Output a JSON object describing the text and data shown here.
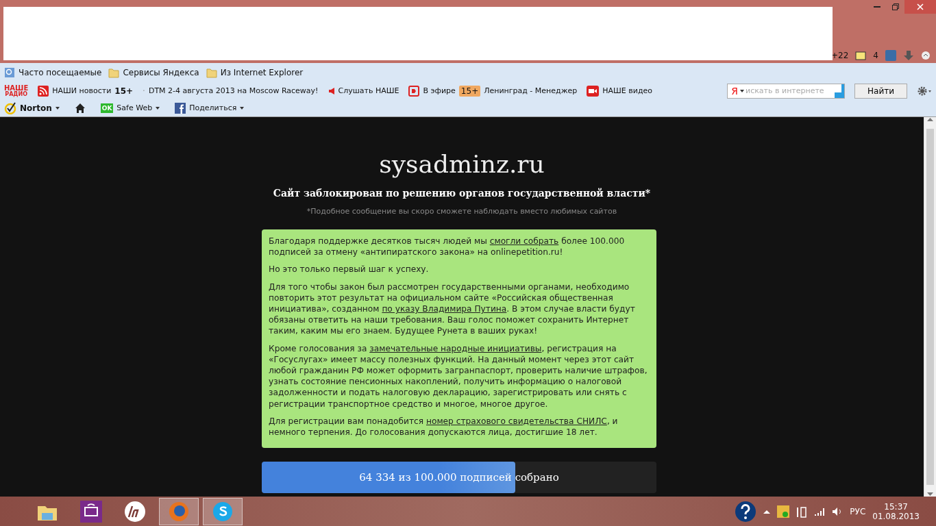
{
  "nav_bar": {
    "weather": "+22",
    "mail_count": "4"
  },
  "bookmarks": [
    {
      "kind": "search",
      "label": "Часто посещаемые"
    },
    {
      "kind": "folder",
      "label": "Сервисы Яндекса"
    },
    {
      "kind": "folder",
      "label": "Из Internet Explorer"
    }
  ],
  "radio_bar": {
    "logo_top": "НАШЕ",
    "logo_bottom": "РАДИО",
    "items": [
      {
        "kind": "rss",
        "label": "НАШИ новости",
        "badge": "15+"
      },
      {
        "kind": "dot",
        "label": "DTM 2-4 августа 2013 на Moscow Raceway!"
      },
      {
        "kind": "speaker",
        "label": "Слушать НАШЕ"
      },
      {
        "kind": "live",
        "label": "В эфире",
        "badge": "15+",
        "extra": "Ленинград - Менеджер"
      },
      {
        "kind": "video",
        "label": "НАШЕ видео"
      }
    ],
    "separator": "·",
    "search": {
      "logo": "Я",
      "placeholder": "искать в интернете",
      "button": "Найти"
    }
  },
  "norton_bar": {
    "brand": "Norton",
    "safe_web_badge": "OK",
    "safe_web": "Safe Web",
    "share": "Поделиться"
  },
  "page": {
    "site": "sysadminz.ru",
    "headline": "Сайт заблокирован по решению органов государственной власти*",
    "note": "*Подобное сообщение вы скоро сможете наблюдать вместо любимых сайтов",
    "paragraphs": [
      [
        {
          "kind": "text",
          "text": "Благодаря поддержке десятков тысяч людей мы "
        },
        {
          "kind": "link",
          "text": "смогли собрать"
        },
        {
          "kind": "text",
          "text": " более 100.000 подписей за отмену «антипиратского закона» на onlinepetition.ru!"
        }
      ],
      [
        {
          "kind": "text",
          "text": "Но это только первый шаг к успеху."
        }
      ],
      [
        {
          "kind": "text",
          "text": "Для того чтобы закон был рассмотрен государственными органами, необходимо повторить этот результат на официальном сайте «Российская общественная инициатива», созданном "
        },
        {
          "kind": "link",
          "text": "по указу Владимира Путина"
        },
        {
          "kind": "text",
          "text": ". В этом случае власти будут обязаны ответить на наши требования. Ваш голос поможет сохранить Интернет таким, каким мы его знаем. Будущее Рунета в ваших руках!"
        }
      ],
      [
        {
          "kind": "text",
          "text": "Кроме голосования за "
        },
        {
          "kind": "link",
          "text": "замечательные народные инициативы"
        },
        {
          "kind": "text",
          "text": ", регистрация на «Госуслугах» имеет массу полезных функций. На данный момент через этот сайт любой гражданин РФ может оформить загранпаспорт, проверить наличие штрафов, узнать состояние пенсионных накоплений, получить информацию о налоговой задолженности и подать налоговую декларацию, зарегистрировать или снять с регистрации транспортное средство и многое, многое другое."
        }
      ],
      [
        {
          "kind": "text",
          "text": "Для регистрации вам понадобится "
        },
        {
          "kind": "link",
          "text": "номер страхового свидетельства СНИЛС"
        },
        {
          "kind": "text",
          "text": ", и немного терпения. До голосования допускаются лица, достигшие 18 лет."
        }
      ]
    ],
    "progress": {
      "label": "64 334 из 100.000 подписей собрано",
      "level": 0.643
    }
  },
  "taskbar": {
    "apps": [
      {
        "kind": "folder",
        "selected": false
      },
      {
        "kind": "remote",
        "selected": false
      },
      {
        "kind": "hp",
        "selected": false
      },
      {
        "kind": "firefox",
        "selected": true
      },
      {
        "kind": "skype",
        "selected": true
      }
    ],
    "language": "РУС",
    "time": "15:37",
    "date": "01.08.2013"
  }
}
